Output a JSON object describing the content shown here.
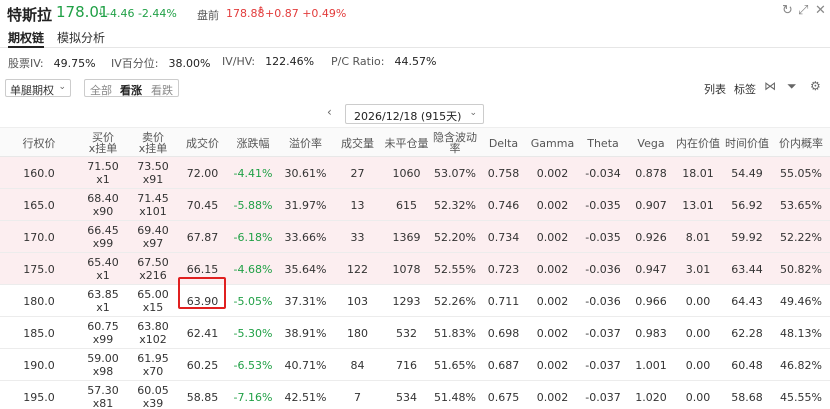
{
  "header": {
    "stock_name": "特斯拉",
    "price": "178.01",
    "change": "-4.46 -2.44%",
    "premarket_label": "盘前",
    "premarket_price": "178.88",
    "premarket_change": "+0.87 +0.49%"
  },
  "tabs": [
    {
      "label": "期权链",
      "active": true
    },
    {
      "label": "模拟分析",
      "active": false
    }
  ],
  "stats": [
    {
      "label": "股票IV:",
      "value": "49.75%"
    },
    {
      "label": "IV百分位:",
      "value": "38.00%"
    },
    {
      "label": "IV/HV:",
      "value": "122.46%"
    },
    {
      "label": "P/C Ratio:",
      "value": "44.57%"
    }
  ],
  "controls": {
    "mode_select": "单腿期权",
    "segments": [
      {
        "label": "全部",
        "active": false
      },
      {
        "label": "看涨",
        "active": true
      },
      {
        "label": "看跌",
        "active": false
      }
    ],
    "list_label": "列表",
    "tag_label": "标签"
  },
  "expiry": {
    "selected": "2026/12/18 (915天)"
  },
  "columns": [
    "行权价",
    "买价\nx挂单",
    "卖价\nx挂单",
    "成交价",
    "涨跌幅",
    "溢价率",
    "成交量",
    "未平仓量",
    "隐含波动率",
    "Delta",
    "Gamma",
    "Theta",
    "Vega",
    "内在价值",
    "时间价值",
    "价内概率"
  ],
  "rows": [
    {
      "strike": "160.0",
      "bid": "71.50",
      "bid_size": "x1",
      "ask": "73.50",
      "ask_size": "x91",
      "last": "72.00",
      "chg": "-4.41%",
      "premium": "30.61%",
      "volume": "27",
      "oi": "1060",
      "iv": "53.07%",
      "delta": "0.758",
      "gamma": "0.002",
      "theta": "-0.034",
      "vega": "0.878",
      "intrinsic": "18.01",
      "time_value": "54.49",
      "itm_prob": "55.05%",
      "itm": true
    },
    {
      "strike": "165.0",
      "bid": "68.40",
      "bid_size": "x90",
      "ask": "71.45",
      "ask_size": "x101",
      "last": "70.45",
      "chg": "-5.88%",
      "premium": "31.97%",
      "volume": "13",
      "oi": "615",
      "iv": "52.32%",
      "delta": "0.746",
      "gamma": "0.002",
      "theta": "-0.035",
      "vega": "0.907",
      "intrinsic": "13.01",
      "time_value": "56.92",
      "itm_prob": "53.65%",
      "itm": true
    },
    {
      "strike": "170.0",
      "bid": "66.45",
      "bid_size": "x99",
      "ask": "69.40",
      "ask_size": "x97",
      "last": "67.87",
      "chg": "-6.18%",
      "premium": "33.66%",
      "volume": "33",
      "oi": "1369",
      "iv": "52.20%",
      "delta": "0.734",
      "gamma": "0.002",
      "theta": "-0.035",
      "vega": "0.926",
      "intrinsic": "8.01",
      "time_value": "59.92",
      "itm_prob": "52.22%",
      "itm": true
    },
    {
      "strike": "175.0",
      "bid": "65.40",
      "bid_size": "x1",
      "ask": "67.50",
      "ask_size": "x216",
      "last": "66.15",
      "chg": "-4.68%",
      "premium": "35.64%",
      "volume": "122",
      "oi": "1078",
      "iv": "52.55%",
      "delta": "0.723",
      "gamma": "0.002",
      "theta": "-0.036",
      "vega": "0.947",
      "intrinsic": "3.01",
      "time_value": "63.44",
      "itm_prob": "50.82%",
      "itm": true
    },
    {
      "strike": "180.0",
      "bid": "63.85",
      "bid_size": "x1",
      "ask": "65.00",
      "ask_size": "x15",
      "last": "63.90",
      "chg": "-5.05%",
      "premium": "37.31%",
      "volume": "103",
      "oi": "1293",
      "iv": "52.26%",
      "delta": "0.711",
      "gamma": "0.002",
      "theta": "-0.036",
      "vega": "0.966",
      "intrinsic": "0.00",
      "time_value": "64.43",
      "itm_prob": "49.46%",
      "itm": false
    },
    {
      "strike": "185.0",
      "bid": "60.75",
      "bid_size": "x99",
      "ask": "63.80",
      "ask_size": "x102",
      "last": "62.41",
      "chg": "-5.30%",
      "premium": "38.91%",
      "volume": "180",
      "oi": "532",
      "iv": "51.83%",
      "delta": "0.698",
      "gamma": "0.002",
      "theta": "-0.037",
      "vega": "0.983",
      "intrinsic": "0.00",
      "time_value": "62.28",
      "itm_prob": "48.13%",
      "itm": false
    },
    {
      "strike": "190.0",
      "bid": "59.00",
      "bid_size": "x98",
      "ask": "61.95",
      "ask_size": "x70",
      "last": "60.25",
      "chg": "-6.53%",
      "premium": "40.71%",
      "volume": "84",
      "oi": "716",
      "iv": "51.65%",
      "delta": "0.687",
      "gamma": "0.002",
      "theta": "-0.037",
      "vega": "1.001",
      "intrinsic": "0.00",
      "time_value": "60.48",
      "itm_prob": "46.82%",
      "itm": false
    },
    {
      "strike": "195.0",
      "bid": "57.30",
      "bid_size": "x81",
      "ask": "60.05",
      "ask_size": "x39",
      "last": "58.85",
      "chg": "-7.16%",
      "premium": "42.51%",
      "volume": "7",
      "oi": "534",
      "iv": "51.48%",
      "delta": "0.675",
      "gamma": "0.002",
      "theta": "-0.037",
      "vega": "1.020",
      "intrinsic": "0.00",
      "time_value": "58.68",
      "itm_prob": "45.55%",
      "itm": false
    }
  ],
  "colors": {
    "up": "#e23c3c",
    "down": "#20a046",
    "itm_row": "#fceef0",
    "highlight": "#e02020"
  }
}
